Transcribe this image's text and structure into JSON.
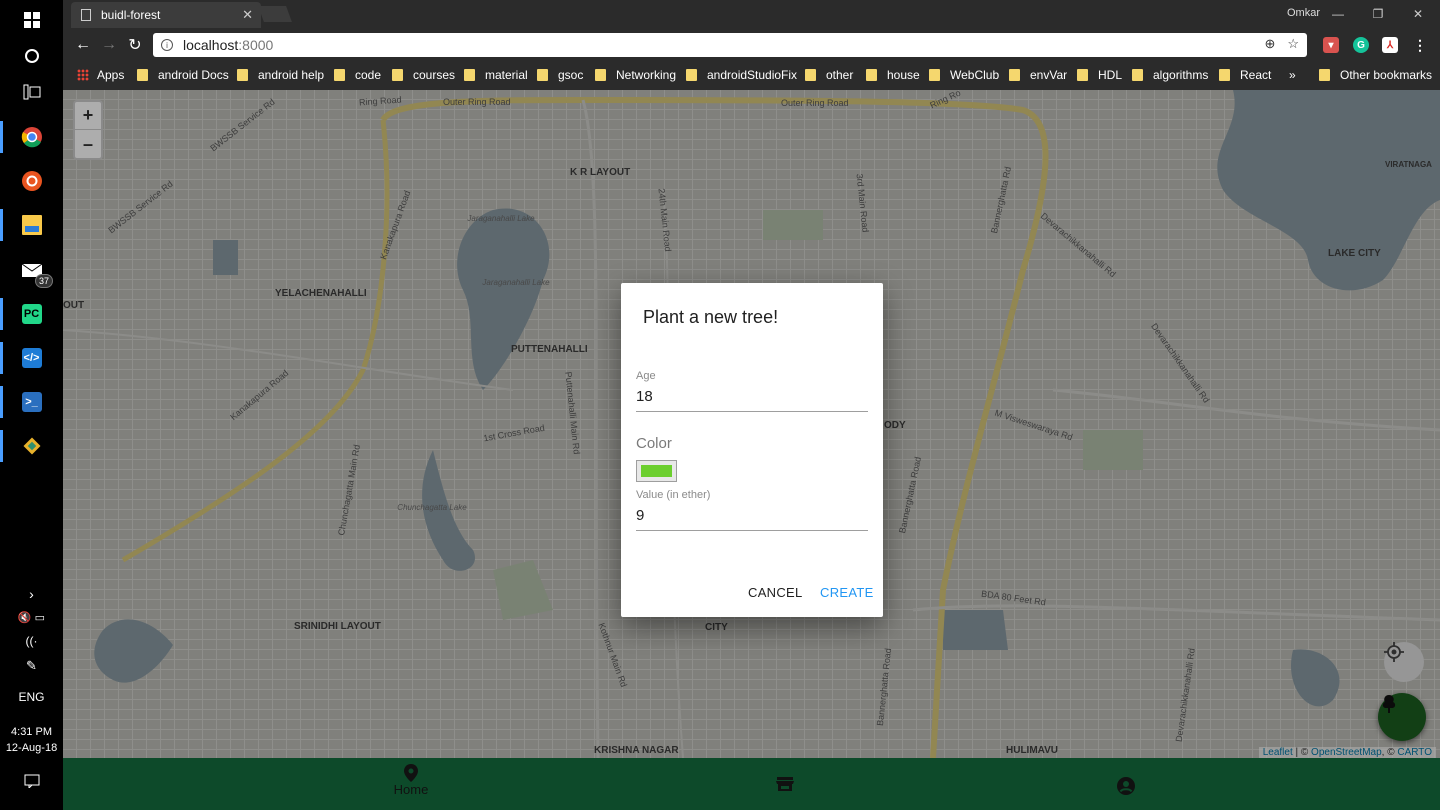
{
  "taskbar": {
    "tray_lang": "ENG",
    "clock_time": "4:31 PM",
    "clock_date": "12-Aug-18",
    "mail_badge": "37",
    "icons": [
      "windows-start-icon",
      "cortana-icon",
      "task-view-icon",
      "chrome-icon",
      "ubuntu-icon",
      "file-explorer-icon",
      "mail-icon",
      "pycharm-icon",
      "vscode-icon",
      "powershell-icon",
      "git-icon"
    ]
  },
  "browser": {
    "tab_title": "buidl-forest",
    "profile_name": "Omkar",
    "url_host": "localhost",
    "url_port": ":8000",
    "bookmarks": [
      "Apps",
      "android Docs",
      "android help",
      "code",
      "courses",
      "material",
      "gsoc",
      "Networking",
      "androidStudioFix",
      "other",
      "house",
      "WebClub",
      "envVar",
      "HDL",
      "algorithms",
      "React"
    ],
    "bookmarks_overflow": "»",
    "other_bookmarks": "Other bookmarks"
  },
  "map": {
    "zoom_in": "+",
    "zoom_out": "–",
    "labels": {
      "kr_layout": "K R LAYOUT",
      "yelachenahalli": "YELACHENAHALLI",
      "puttenahalli": "PUTTENAHALLI",
      "lake_city": "LAKE CITY",
      "srinidhi": "SRINIDHI LAYOUT",
      "krishna_nagar": "KRISHNA NAGAR",
      "hulimavu": "HULIMAVU",
      "viratnagar": "VIRATNAGA",
      "city": "CITY",
      "ody": "ODY",
      "out": "OUT"
    },
    "streets": {
      "outer_ring_1": "Outer Ring Road",
      "outer_ring_2": "Outer Ring Road",
      "ring_road_left": "Ring Road",
      "ring_road_right": "Ring Ro",
      "bwssb_1": "BWSSB Service Rd",
      "bwssb_2": "BWSSB Service Rd",
      "kanakapura_1": "Kanakapura Road",
      "kanakapura_2": "Kanakapura Road",
      "main_24th": "24th Main Road",
      "main_3rd": "3rd Main Road",
      "bannerghatta_1": "Bannerghatta Rd",
      "bannerghatta_2": "Bannerghatta Road",
      "bannerghatta_3": "Bannerghatta Road",
      "devarachikkanahalli_1": "Devarachikkanahalli Rd",
      "devarachikkanahalli_2": "Devarachikkanahalli Rd",
      "devarachikkanahalli_3": "Devarachikkanahalli Rd",
      "m_visweswaraya": "M Visweswaraya Rd",
      "puttenahalli_main": "Puttenahalli Main Rd",
      "first_cross": "1st Cross Road",
      "chunchagatta_main": "Chunchagatta Main Rd",
      "kothnur_main": "Kothnur Main Rd",
      "bda_80": "BDA 80 Feet Rd"
    },
    "water": {
      "jaraganahalli_1": "Jaraganahalli Lake",
      "jaraganahalli_2": "Jaraganahalli Lake",
      "chunchagatta": "Chunchagatta Lake"
    },
    "attribution": {
      "leaflet": "Leaflet",
      "sep1": " | © ",
      "osm": "OpenStreetMap",
      "sep2": ", © ",
      "carto": "CARTO"
    }
  },
  "dialog": {
    "title": "Plant a new tree!",
    "age_label": "Age",
    "age_value": "18",
    "color_label": "Color",
    "color_value": "#6ccf2e",
    "value_label": "Value (in ether)",
    "value_value": "9",
    "cancel_label": "CANCEL",
    "create_label": "CREATE"
  },
  "bottom_nav": {
    "home_label": "Home",
    "items": [
      "home-icon",
      "store-icon",
      "account-icon"
    ]
  },
  "colors": {
    "accent": "#2196f3",
    "nav_bg": "#0d4a2a",
    "fab_bg": "#1b5e20"
  }
}
